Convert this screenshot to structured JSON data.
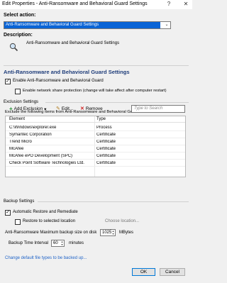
{
  "window": {
    "title": "Edit Properties - Anti-Ransomware and Behavioral Guard Settings",
    "help_label": "?",
    "close_label": "✕"
  },
  "select_action": {
    "label": "Select action:",
    "value": "Anti-Ransomware and Behavioral Guard Settings",
    "arrow": "⌄"
  },
  "description": {
    "label": "Description:",
    "text": "Anti-Ransomware and Behavioral Guard Settings",
    "icon": "magnifier-icon"
  },
  "main_heading": "Anti-Ransomware and Behavioral Guard Settings",
  "enable_guard": {
    "label": "Enable Anti-Ransomware and Behavioral Guard",
    "checked": true
  },
  "enable_network": {
    "label": "Enable network share protection (change will take affect after computer restart)",
    "checked": false
  },
  "exclusion": {
    "title": "Exclusion Settings",
    "intro": "Exclude the following items from Anti-Ransomware and Behavioral Guard:",
    "toolbar": {
      "add_label": "Add Exclusion",
      "add_arrow": "▾",
      "edit_label": "Edit...",
      "remove_label": "Remove",
      "search_placeholder": "Type to Search"
    },
    "columns": {
      "element": "Element",
      "type": "Type"
    },
    "rows": [
      {
        "element": "C:\\Windows\\explorer.exe",
        "type": "Process"
      },
      {
        "element": "Symantec Corporation",
        "type": "Certificate"
      },
      {
        "element": "Trend Micro",
        "type": "Certificate"
      },
      {
        "element": "McAfee",
        "type": "Certificate"
      },
      {
        "element": "McAfee ePO Development (SPC)",
        "type": "Certificate"
      },
      {
        "element": "Check Point Software Technologies Ltd.",
        "type": "Certificate"
      }
    ]
  },
  "backup": {
    "title": "Backup Settings",
    "auto_restore": {
      "label": "Automatic Restore and Remediate",
      "checked": true
    },
    "restore_selected": {
      "label": "Restore to selected location",
      "checked": false
    },
    "choose_location": "Choose location...",
    "max_size_label": "Anti-Ransomware Maximum backup size on disk",
    "max_size_value": "1025",
    "max_size_unit": "MBytes",
    "interval_label": "Backup Time Interval",
    "interval_value": "60",
    "interval_unit": "minutes",
    "change_link": "Change default file types to be backed up..."
  },
  "buttons": {
    "ok": "OK",
    "cancel": "Cancel"
  },
  "colors": {
    "accent": "#0a64d6",
    "heading": "#1f3d7a",
    "link": "#1f63c7"
  }
}
